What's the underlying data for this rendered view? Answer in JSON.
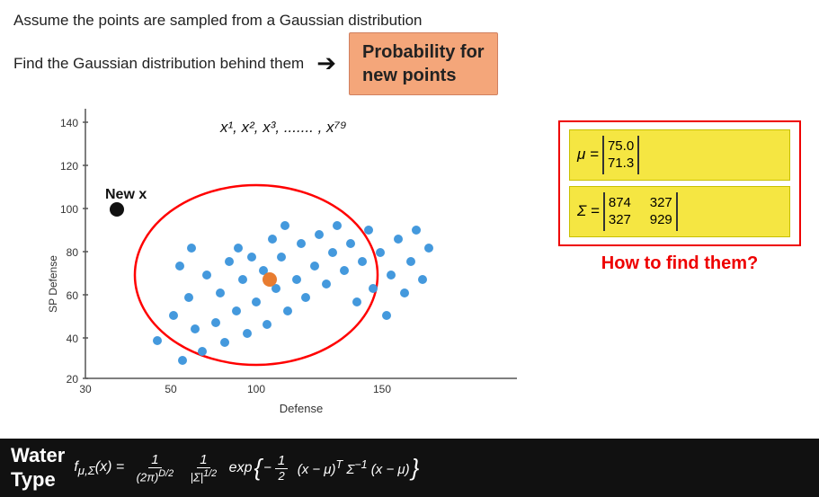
{
  "header": {
    "line1": "Assume the points are sampled from a Gaussian distribution",
    "line2": "Find the Gaussian distribution behind them"
  },
  "probability_box": {
    "line1": "Probability for",
    "line2": "new points"
  },
  "chart": {
    "x_label": "Defense",
    "y_label": "SP Defense",
    "new_x_label": "New x",
    "points_label": "x¹, x², x³, ....... , x⁷⁹"
  },
  "mu_formula": {
    "label": "μ = ",
    "value_line1": "75.0",
    "value_line2": "71.3"
  },
  "sigma_formula": {
    "label": "Σ = ",
    "r1c1": "874",
    "r1c2": "327",
    "r2c1": "327",
    "r2c2": "929"
  },
  "how_text": "How to find them?",
  "bottom": {
    "water_type": "Water\nType",
    "formula_display": "f_{μ,Σ}(x) = 1/(2π)^{D/2} · 1/|Σ|^{1/2} · exp{ -1/2 (x-μ)^T Σ^{-1} (x-μ) }"
  }
}
